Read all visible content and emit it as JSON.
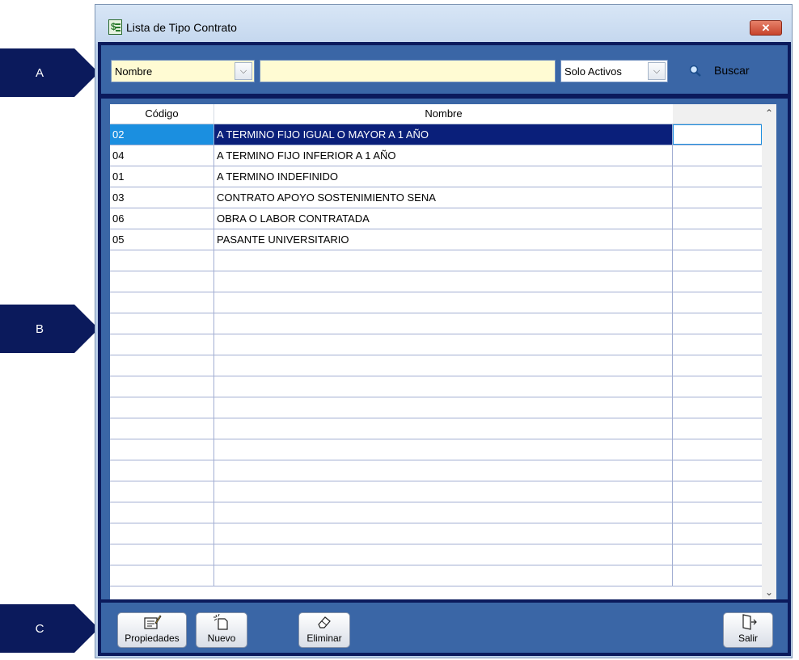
{
  "callouts": {
    "a": "A",
    "b": "B",
    "c": "C"
  },
  "window": {
    "title": "Lista de Tipo Contrato",
    "close_glyph": "✕"
  },
  "toolbar": {
    "field_selected": "Nombre",
    "search_value": "",
    "status_selected": "Solo Activos",
    "search_label": "Buscar",
    "dropdown_glyph": "⌵"
  },
  "grid": {
    "headers": [
      "Código",
      "Nombre",
      ""
    ],
    "rows": [
      {
        "codigo": "02",
        "nombre": "A TERMINO FIJO IGUAL O MAYOR A 1 AÑO",
        "selected": true
      },
      {
        "codigo": "04",
        "nombre": "A TERMINO FIJO INFERIOR A 1 AÑO"
      },
      {
        "codigo": "01",
        "nombre": "A TERMINO INDEFINIDO"
      },
      {
        "codigo": "03",
        "nombre": "CONTRATO APOYO SOSTENIMIENTO SENA"
      },
      {
        "codigo": "06",
        "nombre": "OBRA O LABOR CONTRATADA"
      },
      {
        "codigo": "05",
        "nombre": "PASANTE UNIVERSITARIO"
      }
    ],
    "empty_row_count": 16,
    "scroll_up_glyph": "⌃",
    "scroll_down_glyph": "⌄"
  },
  "buttons": {
    "properties": "Propiedades",
    "new": "Nuevo",
    "delete": "Eliminar",
    "exit": "Salir"
  },
  "icons": {
    "app": "document-dollar-icon",
    "search": "magnifier-icon",
    "properties": "edit-document-icon",
    "new": "new-document-icon",
    "delete": "eraser-icon",
    "exit": "exit-door-icon"
  },
  "colors": {
    "selection_row": "#0a1f7a",
    "selection_cell": "#1b8fe0",
    "frame": "#0b1a5c",
    "panel": "#3a66a6",
    "input_bg": "#fffbd3"
  }
}
